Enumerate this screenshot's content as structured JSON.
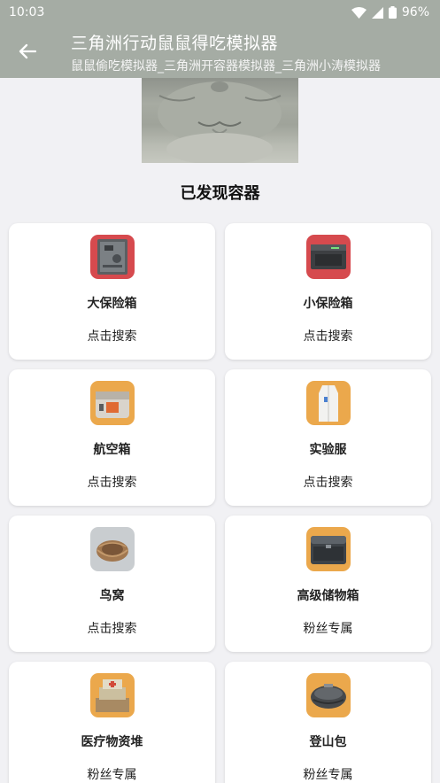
{
  "status_bar": {
    "time": "10:03",
    "battery": "96%"
  },
  "app_bar": {
    "title": "三角洲行动鼠鼠得吃模拟器",
    "subtitle": "鼠鼠偷吃模拟器_三角洲开容器模拟器_三角洲小涛模拟器"
  },
  "section_title": "已发现容器",
  "containers": [
    {
      "name": "大保险箱",
      "action": "点击搜索",
      "icon": "large-safe-icon",
      "bg": "#d64a4e"
    },
    {
      "name": "小保险箱",
      "action": "点击搜索",
      "icon": "small-safe-icon",
      "bg": "#d64a4e"
    },
    {
      "name": "航空箱",
      "action": "点击搜索",
      "icon": "air-case-icon",
      "bg": "#eba84c"
    },
    {
      "name": "实验服",
      "action": "点击搜索",
      "icon": "lab-coat-icon",
      "bg": "#eba84c"
    },
    {
      "name": "鸟窝",
      "action": "点击搜索",
      "icon": "bird-nest-icon",
      "bg": "#c9cdd0"
    },
    {
      "name": "高级储物箱",
      "action": "粉丝专属",
      "icon": "storage-box-icon",
      "bg": "#eba84c"
    },
    {
      "name": "医疗物资堆",
      "action": "粉丝专属",
      "icon": "medical-supplies-icon",
      "bg": "#eba84c"
    },
    {
      "name": "登山包",
      "action": "粉丝专属",
      "icon": "backpack-icon",
      "bg": "#eba84c"
    }
  ]
}
